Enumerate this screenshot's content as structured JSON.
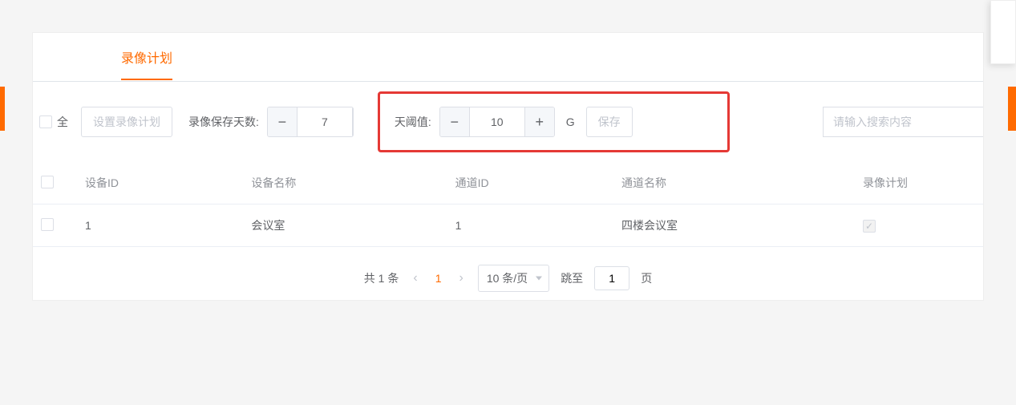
{
  "tab": {
    "title": "录像计划"
  },
  "toolbar": {
    "select_all_label": "全",
    "set_plan_button": "设置录像计划",
    "days_label": "录像保存天数:",
    "days_value": "7",
    "threshold_label": "天阈值:",
    "threshold_value": "10",
    "unit_g": "G",
    "save_button": "保存",
    "search_placeholder": "请输入搜索内容"
  },
  "table": {
    "headers": {
      "device_id": "设备ID",
      "device_name": "设备名称",
      "channel_id": "通道ID",
      "channel_name": "通道名称",
      "plan": "录像计划"
    },
    "rows": [
      {
        "device_id": "1",
        "device_name": "会议室",
        "channel_id": "1",
        "channel_name": "四楼会议室",
        "plan_checked": true
      }
    ]
  },
  "pagination": {
    "total_text": "共 1 条",
    "current_page": "1",
    "page_size_label": "10 条/页",
    "jump_label": "跳至",
    "jump_value": "1",
    "page_suffix": "页"
  }
}
